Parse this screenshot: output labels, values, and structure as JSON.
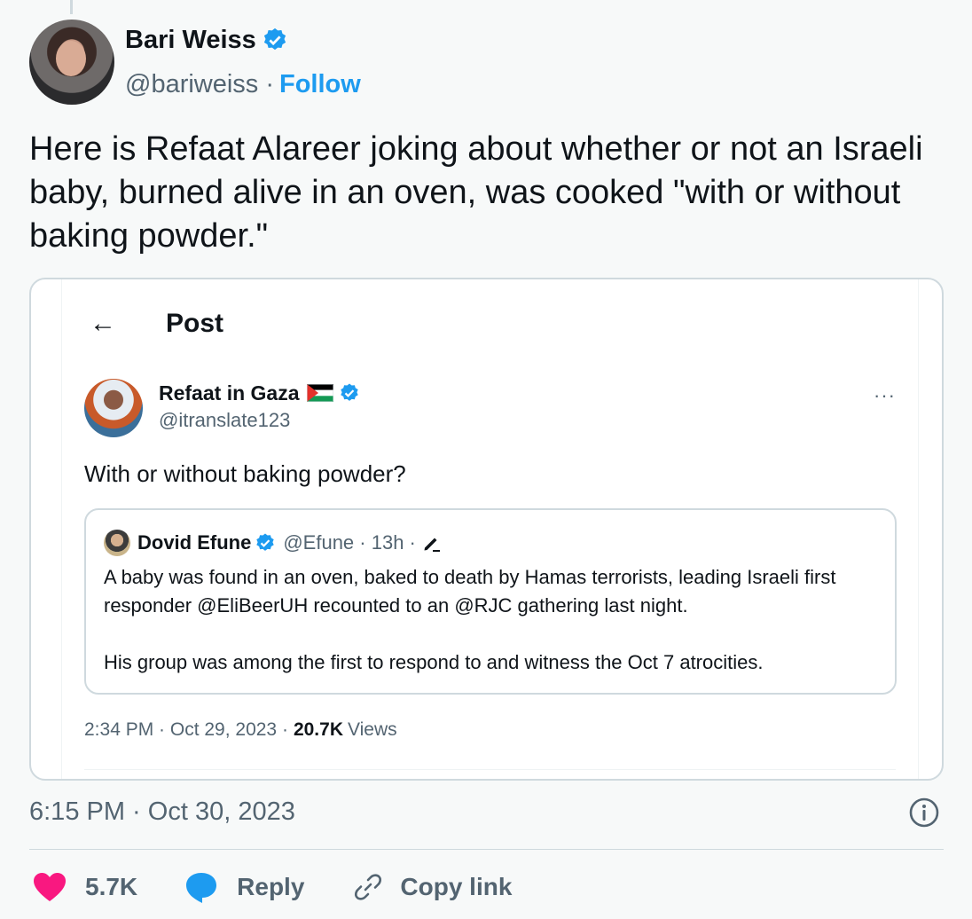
{
  "author": {
    "name": "Bari Weiss",
    "handle": "@bariweiss",
    "separator": "·",
    "follow_label": "Follow"
  },
  "tweet": {
    "text": "Here is Refaat Alareer joking about whether or not an Israeli baby, burned alive in an oven, was cooked \"with or without baking powder.\"",
    "timestamp": "6:15 PM · Oct 30, 2023"
  },
  "embedded_post": {
    "back_icon": "←",
    "header_title": "Post",
    "author_name": "Refaat in Gaza",
    "author_handle": "@itranslate123",
    "more_icon": "···",
    "text": "With or without baking powder?",
    "quote": {
      "author_name": "Dovid Efune",
      "meta": "@Efune · 13h ·",
      "paragraph1": "A baby was found in an oven, baked to death by Hamas terrorists, leading Israeli first responder @EliBeerUH recounted to an @RJC gathering last night.",
      "paragraph2": "His group was among the first to respond to and witness the Oct 7 atrocities."
    },
    "footer_time": "2:34 PM · Oct 29, 2023 ·",
    "views_count": "20.7K",
    "views_label": "Views"
  },
  "actions": {
    "like_count": "5.7K",
    "reply_label": "Reply",
    "copy_link_label": "Copy link"
  },
  "colors": {
    "accent": "#1d9bf0",
    "like": "#f91880",
    "muted_text": "#536471"
  },
  "icons": [
    "verified-badge-icon",
    "back-arrow-icon",
    "palestine-flag-icon",
    "more-icon",
    "edit-pencil-icon",
    "info-icon",
    "heart-icon",
    "reply-bubble-icon",
    "link-icon"
  ]
}
